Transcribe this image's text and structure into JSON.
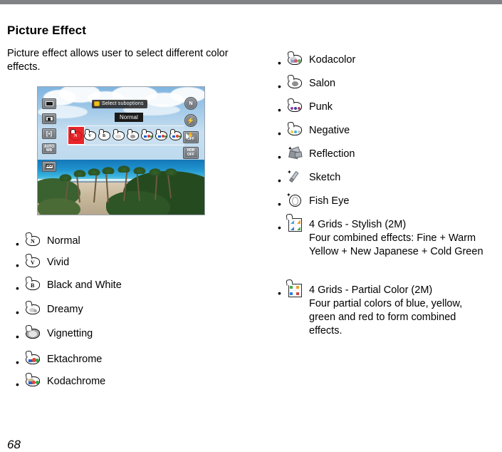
{
  "document": {
    "page_number": "68",
    "title": "Picture Effect",
    "intro": "Picture effect allows user to select different color effects."
  },
  "camera_screen": {
    "name": "camera-lcd-screenshot",
    "tooltip": "Select suboptions",
    "selected_label": "Normal",
    "left_icons": [
      {
        "name": "image-size-icon",
        "label": ""
      },
      {
        "name": "metering-icon",
        "label": ""
      },
      {
        "name": "af-area-icon",
        "label": ""
      },
      {
        "name": "white-balance-icon",
        "label": "AUTO WB"
      },
      {
        "name": "iso-icon",
        "label": "ISO"
      }
    ],
    "right_icons": [
      {
        "name": "picture-effect-icon",
        "label": "N"
      },
      {
        "name": "flash-off-icon",
        "label": ""
      },
      {
        "name": "anti-shake-off-icon",
        "label": "OFF"
      },
      {
        "name": "hdr-off-icon",
        "label": "HDR OFF"
      }
    ],
    "effect_strip": [
      {
        "name": "effect-normal",
        "letter": "N",
        "selected": true
      },
      {
        "name": "effect-vivid",
        "letter": "V",
        "selected": false
      },
      {
        "name": "effect-black-and-white",
        "letter": "B",
        "selected": false
      },
      {
        "name": "effect-dreamy",
        "letter": "",
        "selected": false
      },
      {
        "name": "effect-vignetting",
        "letter": "",
        "selected": false
      },
      {
        "name": "effect-ektachrome",
        "letter": "",
        "selected": false
      },
      {
        "name": "effect-kodachrome",
        "letter": "",
        "selected": false
      },
      {
        "name": "effect-kodacolor",
        "letter": "",
        "selected": false
      }
    ],
    "more_arrow": "▶"
  },
  "left_list": {
    "name": "picture-effect-list-left",
    "bullet": "•",
    "items": [
      {
        "icon": "effect-normal-icon",
        "label": "Normal",
        "letter": "N"
      },
      {
        "icon": "effect-vivid-icon",
        "label": "Vivid",
        "letter": "V"
      },
      {
        "icon": "effect-black-and-white-icon",
        "label": "Black and White",
        "letter": "B"
      },
      {
        "icon": "effect-dreamy-icon",
        "label": "Dreamy",
        "letter": ""
      },
      {
        "icon": "effect-vignetting-icon",
        "label": "Vignetting",
        "letter": ""
      },
      {
        "icon": "effect-ektachrome-icon",
        "label": "Ektachrome",
        "letter": ""
      },
      {
        "icon": "effect-kodachrome-icon",
        "label": "Kodachrome",
        "letter": ""
      }
    ]
  },
  "right_list": {
    "name": "picture-effect-list-right",
    "bullet": "•",
    "items": [
      {
        "icon": "effect-kodacolor-icon",
        "label": "Kodacolor",
        "description": ""
      },
      {
        "icon": "effect-salon-icon",
        "label": "Salon",
        "description": ""
      },
      {
        "icon": "effect-punk-icon",
        "label": "Punk",
        "description": ""
      },
      {
        "icon": "effect-negative-icon",
        "label": "Negative",
        "description": ""
      },
      {
        "icon": "effect-reflection-icon",
        "label": "Reflection",
        "description": ""
      },
      {
        "icon": "effect-sketch-icon",
        "label": "Sketch",
        "description": ""
      },
      {
        "icon": "effect-fish-eye-icon",
        "label": "Fish Eye",
        "description": ""
      },
      {
        "icon": "effect-4-grids-stylish-icon",
        "label": "4 Grids - Stylish (2M)",
        "description": "Four combined effects: Fine + Warm Yellow + New Japanese + Cold Green"
      },
      {
        "icon": "effect-4-grids-partial-color-icon",
        "label": "4 Grids - Partial Color (2M)",
        "description": "Four partial colors of blue, yellow, green and red to form combined effects."
      }
    ]
  },
  "colors": {
    "top_bar": "#808285",
    "text": "#000000",
    "selection_red": "#e8252a",
    "background": "#ffffff"
  }
}
